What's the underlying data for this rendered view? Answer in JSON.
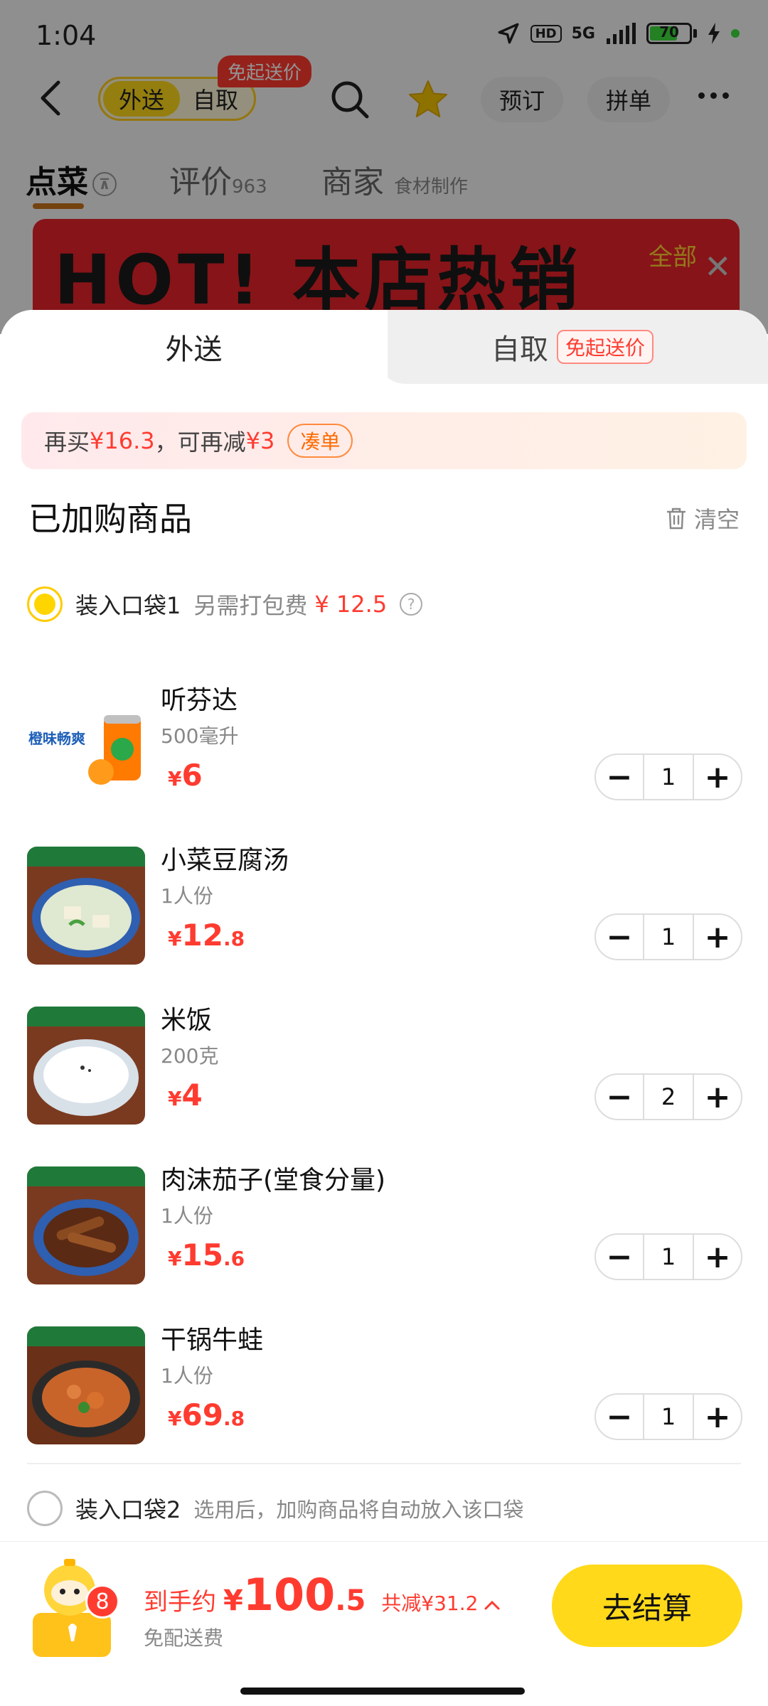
{
  "status_bar": {
    "time": "1:04",
    "hd": "HD",
    "network": "5G",
    "battery": "70",
    "battery_level": 0.7
  },
  "nav": {
    "mode_delivery": "外送",
    "mode_pickup": "自取",
    "free_tag": "免起送价",
    "reserve": "预订",
    "group_order": "拼单"
  },
  "store_tabs": {
    "dishes": "点菜",
    "reviews": "评价",
    "reviews_count": "963",
    "merchant": "商家",
    "merchant_sub": "食材制作"
  },
  "banner": {
    "headline": "HOT! 本店热销",
    "corner": "全部"
  },
  "sheet": {
    "tab_delivery": "外送",
    "tab_pickup": "自取",
    "tab_pickup_tag": "免起送价",
    "promo": {
      "prefix": "再买",
      "amount": "¥16.3",
      "middle": "，可再减",
      "discount": "¥3",
      "cta": "凑单"
    },
    "section_title": "已加购商品",
    "clear": "清空",
    "bag1": {
      "label": "装入口袋1",
      "fee_label": "另需打包费",
      "fee": "¥ 12.5",
      "help": "?"
    },
    "bag2": {
      "label": "装入口袋2",
      "hint": "选用后，加购商品将自动放入该口袋"
    }
  },
  "items": [
    {
      "name": "听芬达",
      "spec": "500毫升",
      "cur": "¥",
      "int": "6",
      "dec": "",
      "qty": "1",
      "thumb_label": "橙味畅爽"
    },
    {
      "name": "小菜豆腐汤",
      "spec": "1人份",
      "cur": "¥",
      "int": "12",
      "dec": ".8",
      "qty": "1"
    },
    {
      "name": "米饭",
      "spec": "200克",
      "cur": "¥",
      "int": "4",
      "dec": "",
      "qty": "2"
    },
    {
      "name": "肉沫茄子(堂食分量)",
      "spec": "1人份",
      "cur": "¥",
      "int": "15",
      "dec": ".6",
      "qty": "1"
    },
    {
      "name": "干锅牛蛙",
      "spec": "1人份",
      "cur": "¥",
      "int": "69",
      "dec": ".8",
      "qty": "1"
    }
  ],
  "stepper": {
    "minus": "−",
    "plus": "+"
  },
  "bottom": {
    "cart_count": "8",
    "total_label": "到手约",
    "total_cur": "¥",
    "total_int": "100",
    "total_dec": ".5",
    "saved": "共减¥31.2",
    "delivery_note": "免配送费",
    "checkout": "去结算"
  },
  "colors": {
    "accent_yellow": "#ffd91a",
    "price_red": "#ff3b30"
  }
}
